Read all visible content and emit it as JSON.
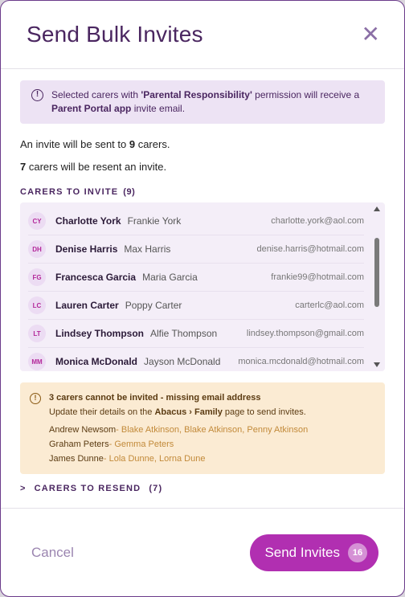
{
  "modal": {
    "title": "Send Bulk Invites",
    "close_symbol": "✕"
  },
  "info": {
    "icon": "info-icon",
    "text_before": "Selected carers with ",
    "permission": "'Parental Responsibility'",
    "text_mid": " permission will receive a ",
    "app": "Parent Portal app",
    "text_after": " invite email."
  },
  "summary": {
    "invite_prefix": "An invite will be sent to ",
    "invite_count": "9",
    "invite_suffix": " carers.",
    "resend_count": "7",
    "resend_suffix": " carers will be resent an invite."
  },
  "invite_section": {
    "label": "CARERS TO INVITE",
    "count": "(9)"
  },
  "carers": [
    {
      "initials": "CY",
      "name": "Charlotte York",
      "child": "Frankie York",
      "email": "charlotte.york@aol.com"
    },
    {
      "initials": "DH",
      "name": "Denise Harris",
      "child": "Max Harris",
      "email": "denise.harris@hotmail.com"
    },
    {
      "initials": "FG",
      "name": "Francesca Garcia",
      "child": "Maria Garcia",
      "email": "frankie99@hotmail.com"
    },
    {
      "initials": "LC",
      "name": "Lauren Carter",
      "child": "Poppy Carter",
      "email": "carterlc@aol.com"
    },
    {
      "initials": "LT",
      "name": "Lindsey Thompson",
      "child": "Alfie Thompson",
      "email": "lindsey.thompson@gmail.com"
    },
    {
      "initials": "MM",
      "name": "Monica McDonald",
      "child": "Jayson McDonald",
      "email": "monica.mcdonald@hotmail.com"
    }
  ],
  "warning": {
    "icon": "alert-icon",
    "title": "3 carers cannot be invited - missing email address",
    "sub_before": "Update their details on the ",
    "sub_link": "Abacus › Family",
    "sub_after": " page to send invites.",
    "missing": [
      {
        "name": "Andrew Newsom",
        "children": "- Blake Atkinson, Blake Atkinson, Penny Atkinson"
      },
      {
        "name": "Graham Peters",
        "children": "- Gemma Peters"
      },
      {
        "name": "James Dunne",
        "children": "- Lola Dunne, Lorna Dune"
      }
    ]
  },
  "resend_section": {
    "label": "CARERS TO RESEND",
    "count": "(7)"
  },
  "footer": {
    "cancel": "Cancel",
    "send": "Send Invites",
    "send_count": "16"
  },
  "colors": {
    "accent": "#b12fb1",
    "heading": "#4a2660",
    "info_bg": "#ede3f4",
    "warn_bg": "#fbebd3"
  }
}
